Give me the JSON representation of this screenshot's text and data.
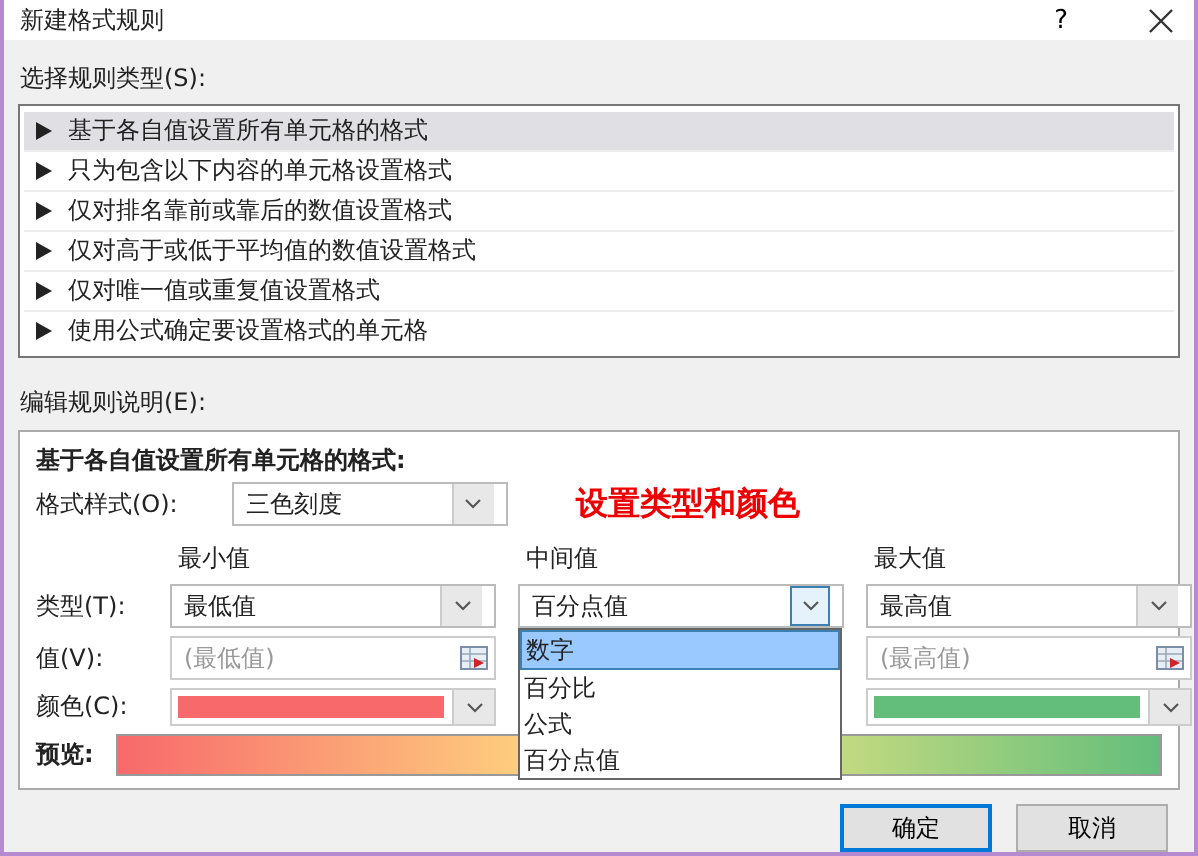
{
  "window": {
    "title": "新建格式规则",
    "help": "?"
  },
  "rule_type_label": "选择规则类型(S):",
  "rule_types": [
    {
      "label": "基于各自值设置所有单元格的格式",
      "selected": true
    },
    {
      "label": "只为包含以下内容的单元格设置格式",
      "selected": false
    },
    {
      "label": "仅对排名靠前或靠后的数值设置格式",
      "selected": false
    },
    {
      "label": "仅对高于或低于平均值的数值设置格式",
      "selected": false
    },
    {
      "label": "仅对唯一值或重复值设置格式",
      "selected": false
    },
    {
      "label": "使用公式确定要设置格式的单元格",
      "selected": false
    }
  ],
  "description_label": "编辑规则说明(E):",
  "description": {
    "heading": "基于各自值设置所有单元格的格式:",
    "style_label": "格式样式(O):",
    "style_value": "三色刻度",
    "annotation": "设置类型和颜色",
    "type_label": "类型(T):",
    "value_label": "值(V):",
    "color_label": "颜色(C):",
    "preview_label": "预览:",
    "columns": [
      {
        "header": "最小值",
        "type_value": "最低值",
        "value_placeholder": "(最低值)",
        "color": "#f8696b"
      },
      {
        "header": "中间值",
        "type_value": "百分点值"
      },
      {
        "header": "最大值",
        "type_value": "最高值",
        "value_placeholder": "(最高值)",
        "color": "#63be7b"
      }
    ],
    "dropdown": {
      "options": [
        {
          "label": "数字",
          "selected": true
        },
        {
          "label": "百分比",
          "selected": false
        },
        {
          "label": "公式",
          "selected": false
        },
        {
          "label": "百分点值",
          "selected": false
        }
      ]
    }
  },
  "buttons": [
    {
      "label": "确定",
      "focused": true
    },
    {
      "label": "取消",
      "focused": false
    }
  ]
}
